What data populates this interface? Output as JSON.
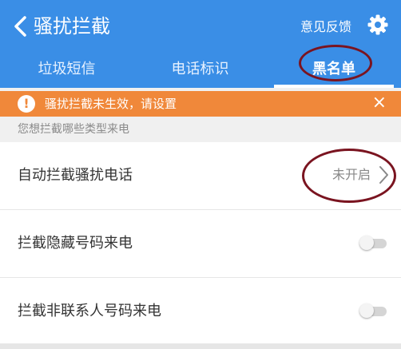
{
  "header": {
    "back_icon": "chevron-left-icon",
    "title": "骚扰拦截",
    "feedback_label": "意见反馈",
    "settings_icon": "gear-icon"
  },
  "tabs": [
    {
      "label": "垃圾短信",
      "active": false
    },
    {
      "label": "电话标识",
      "active": false
    },
    {
      "label": "黑名单",
      "active": true
    }
  ],
  "warning": {
    "icon": "exclamation-icon",
    "text": "骚扰拦截未生效，请设置",
    "close_label": "×"
  },
  "section": {
    "label": "您想拦截哪些类型来电"
  },
  "rows": [
    {
      "label": "自动拦截骚扰电话",
      "value": "未开启"
    },
    {
      "label": "拦截隐藏号码来电",
      "toggle": false
    },
    {
      "label": "拦截非联系人号码来电",
      "toggle": false
    }
  ],
  "colors": {
    "header": "#3a8ee6",
    "warning": "#f0883a",
    "annotation": "#7a1420"
  }
}
